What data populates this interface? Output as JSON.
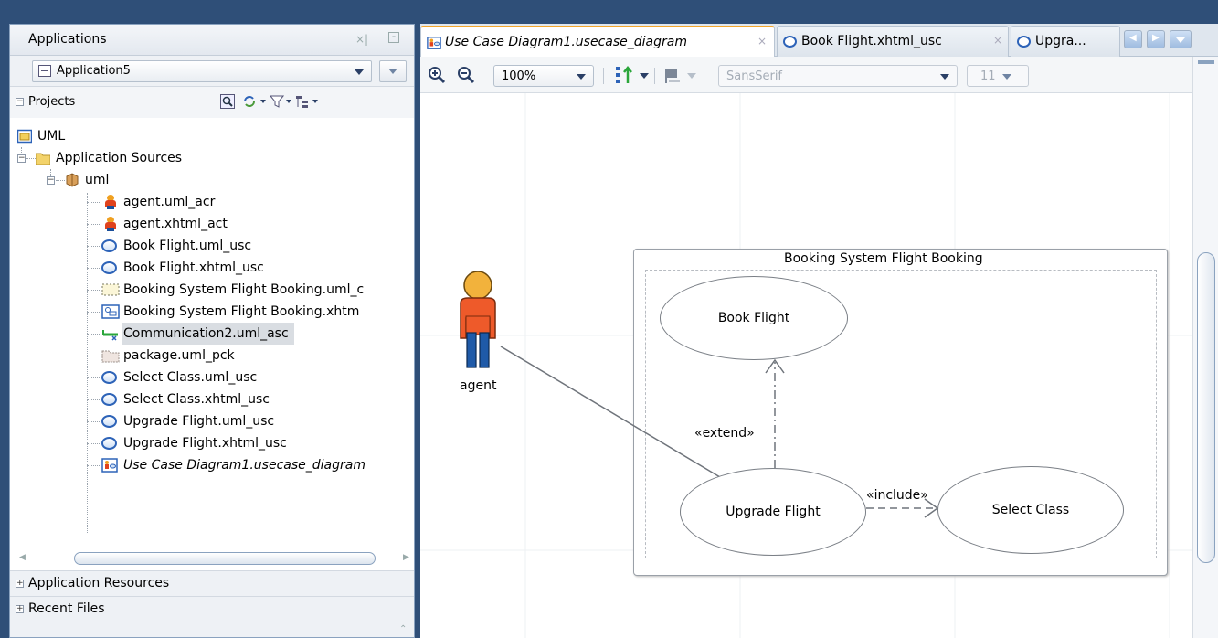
{
  "left_panel": {
    "title": "Applications",
    "application": "Application5",
    "projects_label": "Projects",
    "tree": {
      "root": "UML",
      "sources": "Application Sources",
      "package": "uml",
      "items": [
        {
          "label": "agent.uml_acr",
          "icon": "actor-icon"
        },
        {
          "label": "agent.xhtml_act",
          "icon": "actor-icon"
        },
        {
          "label": "Book Flight.uml_usc",
          "icon": "use-case-icon"
        },
        {
          "label": "Book Flight.xhtml_usc",
          "icon": "use-case-icon"
        },
        {
          "label": "Booking System Flight Booking.uml_c",
          "icon": "boundary-icon"
        },
        {
          "label": "Booking System Flight Booking.xhtm",
          "icon": "class-diagram-icon"
        },
        {
          "label": "Communication2.uml_asc",
          "icon": "association-icon"
        },
        {
          "label": "package.uml_pck",
          "icon": "package-icon"
        },
        {
          "label": "Select Class.uml_usc",
          "icon": "use-case-icon"
        },
        {
          "label": "Select Class.xhtml_usc",
          "icon": "use-case-icon"
        },
        {
          "label": "Upgrade Flight.uml_usc",
          "icon": "use-case-icon"
        },
        {
          "label": "Upgrade Flight.xhtml_usc",
          "icon": "use-case-icon"
        },
        {
          "label": "Use Case Diagram1.usecase_diagram",
          "icon": "usecase-diagram-icon"
        }
      ]
    },
    "app_resources": "Application Resources",
    "recent_files": "Recent Files"
  },
  "editor": {
    "tabs": [
      {
        "label": "Use Case Diagram1.usecase_diagram",
        "active": true
      },
      {
        "label": "Book Flight.xhtml_usc",
        "active": false
      },
      {
        "label": "Upgra...",
        "active": false
      }
    ],
    "toolbar": {
      "zoom": "100%",
      "font": "SansSerif",
      "font_size": "11"
    },
    "diagram": {
      "actor": "agent",
      "boundary_title": "Booking System Flight Booking",
      "use_cases": {
        "book": "Book Flight",
        "upgrade": "Upgrade Flight",
        "select": "Select Class"
      },
      "extend_label": "«extend»",
      "include_label": "«include»"
    }
  }
}
